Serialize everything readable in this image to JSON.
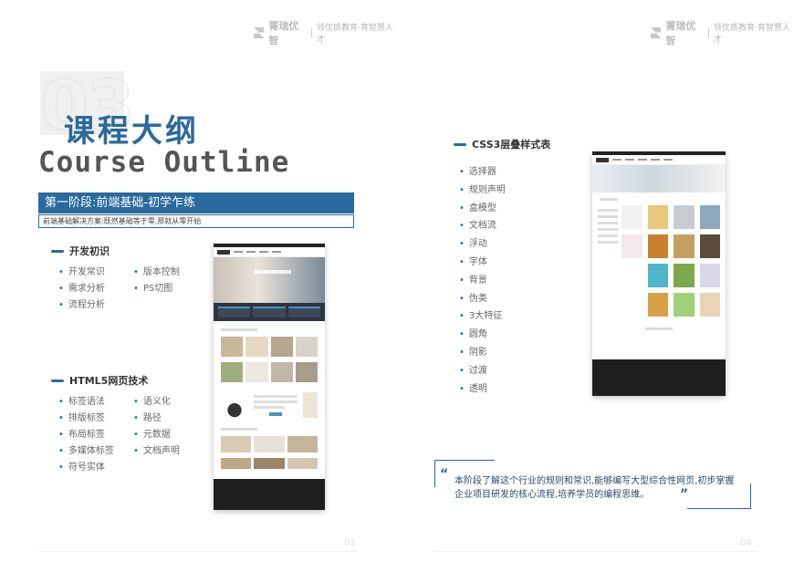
{
  "header": {
    "brand": "菁瑞优智",
    "slogan": "领优质教育·育智慧人才"
  },
  "title": {
    "number": "03",
    "cn": "课程大纲",
    "en": "Course Outline"
  },
  "stage": {
    "title": "第一阶段:前端基础-初学乍练",
    "desc": "前端基础解决方案:既然基础等于零,那就从零开始"
  },
  "sections": {
    "dev": {
      "heading": "开发初识",
      "col1": [
        "开发常识",
        "需求分析",
        "流程分析"
      ],
      "col2": [
        "版本控制",
        "PS切图"
      ]
    },
    "html5": {
      "heading": "HTML5网页技术",
      "col1": [
        "标签语法",
        "排版标签",
        "布局标签",
        "多媒体标签",
        "符号实体"
      ],
      "col2": [
        "语义化",
        "路径",
        "元数据",
        "文档声明"
      ]
    },
    "css3": {
      "heading": "CSS3层叠样式表",
      "items": [
        "选择器",
        "规则声明",
        "盒模型",
        "文档流",
        "浮动",
        "字体",
        "背景",
        "伪类",
        "3大特征",
        "圆角",
        "阴影",
        "过渡",
        "透明"
      ]
    }
  },
  "quote": {
    "open": "“",
    "text": "本阶段了解这个行业的规则和常识,能够编写大型综合性网页,初步掌握企业项目研发的核心流程,培养学员的编程思维。",
    "close": "”"
  },
  "pages": {
    "left": "03",
    "right": "04"
  },
  "colors": {
    "accent": "#2a6a9c",
    "text": "#333333",
    "muted": "#666666"
  }
}
